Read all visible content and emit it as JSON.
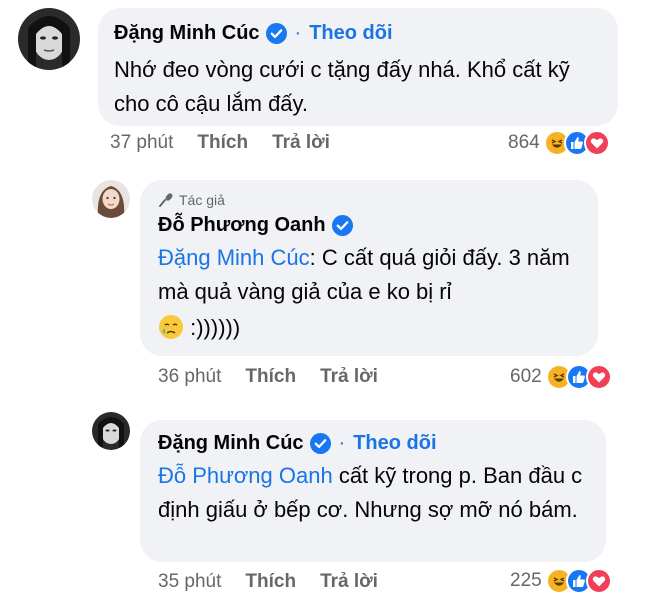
{
  "comments": [
    {
      "author": "Đặng Minh Cúc",
      "follow": "Theo dõi",
      "dot": "·",
      "text": "Nhớ đeo vòng cưới c tặng đấy nhá. Khổ cất kỹ cho cô cậu lắm đấy.",
      "time": "37 phút",
      "like_label": "Thích",
      "reply_label": "Trả lời",
      "reaction_count": "864"
    },
    {
      "badge": "Tác giả",
      "author": "Đỗ Phương Oanh",
      "mention": "Đặng Minh Cúc",
      "text": ": C cất quá giỏi đấy. 3 năm mà quả vàng giả của e ko bị rỉ",
      "text_after_emoji": " :))))))",
      "time": "36 phút",
      "like_label": "Thích",
      "reply_label": "Trả lời",
      "reaction_count": "602"
    },
    {
      "author": "Đặng Minh Cúc",
      "follow": "Theo dõi",
      "dot": "·",
      "mention": "Đỗ Phương Oanh",
      "text": " cất kỹ trong p. Ban đầu c định giấu ở bếp cơ. Nhưng sợ mỡ nó bám.",
      "time": "35 phút",
      "like_label": "Thích",
      "reply_label": "Trả lời",
      "reaction_count": "225"
    }
  ],
  "colors": {
    "bubble": "#f0f2f5",
    "accent": "#1b74e4",
    "meta": "#65676b",
    "haha": "#f7b125",
    "like": "#1877f2",
    "love": "#f33e58"
  },
  "icons": [
    "verified-badge-icon",
    "microphone-icon",
    "haha-reaction-icon",
    "like-reaction-icon",
    "love-reaction-icon",
    "crying-face-emoji"
  ]
}
